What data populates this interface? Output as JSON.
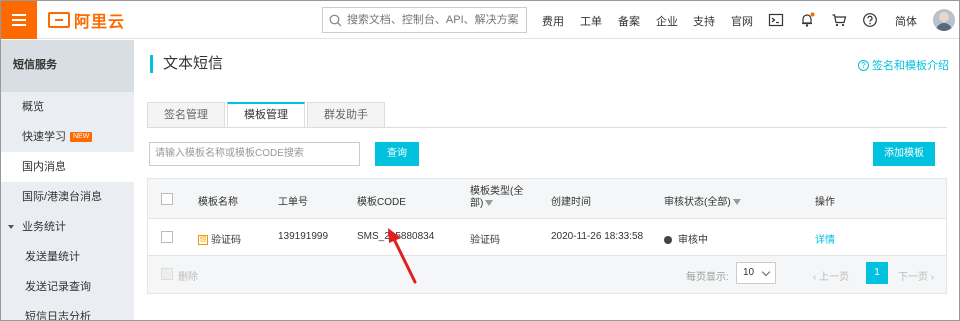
{
  "topbar": {
    "brand": "阿里云",
    "search_placeholder": "搜索文档、控制台、API、解决方案",
    "links": [
      "费用",
      "工单",
      "备案",
      "企业",
      "支持",
      "官网"
    ],
    "language": "简体",
    "brand_color": "#ff6a00"
  },
  "sidebar": {
    "header": "短信服务",
    "items": [
      {
        "label": "概览"
      },
      {
        "label": "快速学习",
        "badge": "NEW"
      },
      {
        "label": "国内消息"
      },
      {
        "label": "国际/港澳台消息"
      },
      {
        "label": "业务统计"
      },
      {
        "label": "发送量统计"
      },
      {
        "label": "发送记录查询"
      },
      {
        "label": "短信日志分析"
      }
    ]
  },
  "main": {
    "title": "文本短信",
    "help_link": "签名和模板介绍",
    "tabs": [
      "签名管理",
      "模板管理",
      "群发助手"
    ],
    "filter_placeholder": "请输入模板名称或模板CODE搜索",
    "query_button": "查询",
    "add_button": "添加模板",
    "accent_color": "#00c1de",
    "table": {
      "headers": [
        "模板名称",
        "工单号",
        "模板CODE",
        "模板类型(全部)",
        "创建时间",
        "审核状态(全部)",
        "操作"
      ],
      "rows": [
        {
          "name": "验证码",
          "ticket": "139191999",
          "code": "SMS_205880834",
          "type": "验证码",
          "created": "2020-11-26 18:33:58",
          "status": "审核中",
          "action": "详情"
        }
      ],
      "footer": {
        "delete_button": "删除",
        "page_size_label": "每页显示:",
        "page_size": "10",
        "prev": "上一页",
        "current_page": "1",
        "next": "下一页"
      }
    }
  }
}
